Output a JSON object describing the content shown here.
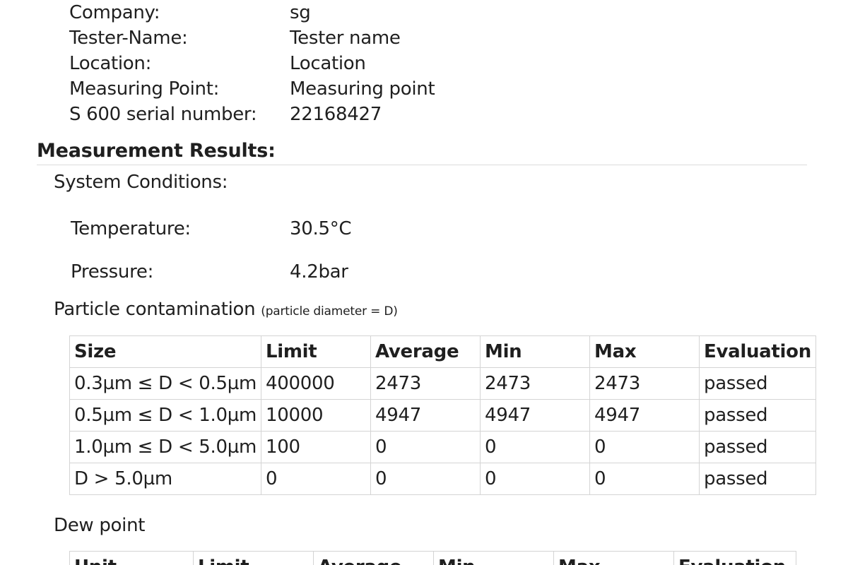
{
  "info": [
    {
      "label": "Company:",
      "value": "sg"
    },
    {
      "label": "Tester-Name:",
      "value": "Tester name"
    },
    {
      "label": "Location:",
      "value": "Location"
    },
    {
      "label": "Measuring Point:",
      "value": "Measuring point"
    },
    {
      "label": "S 600 serial number:",
      "value": "22168427"
    }
  ],
  "results": {
    "heading": "Measurement Results:",
    "system_conditions": {
      "heading": "System Conditions:",
      "temperature": {
        "label": "Temperature:",
        "value": "30.5°C"
      },
      "pressure": {
        "label": "Pressure:",
        "value": "4.2bar"
      }
    },
    "particle": {
      "heading": "Particle contamination",
      "note": "(particle diameter = D)",
      "columns": [
        "Size",
        "Limit",
        "Average",
        "Min",
        "Max",
        "Evaluation"
      ],
      "rows": [
        [
          "0.3µm ≤ D < 0.5µm",
          "400000",
          "2473",
          "2473",
          "2473",
          "passed"
        ],
        [
          "0.5µm ≤ D < 1.0µm",
          "10000",
          "4947",
          "4947",
          "4947",
          "passed"
        ],
        [
          "1.0µm ≤ D < 5.0µm",
          "100",
          "0",
          "0",
          "0",
          "passed"
        ],
        [
          "D > 5.0µm",
          "0",
          "0",
          "0",
          "0",
          "passed"
        ]
      ]
    },
    "dew_point": {
      "heading": "Dew point",
      "columns": [
        "Unit",
        "Limit",
        "Average",
        "Min",
        "Max",
        "Evaluation"
      ]
    }
  }
}
